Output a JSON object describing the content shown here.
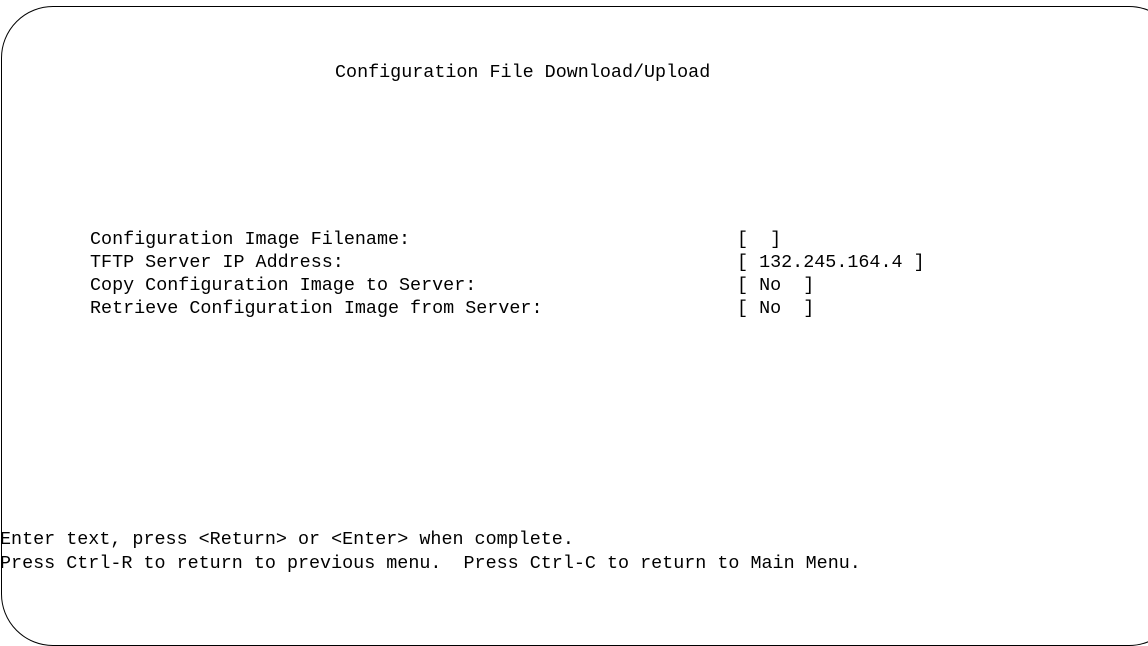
{
  "screen": {
    "title": "Configuration File Download/Upload"
  },
  "fields": [
    {
      "label": "Configuration Image Filename:",
      "value": "[  ]"
    },
    {
      "label": "TFTP Server IP Address:",
      "value": "[ 132.245.164.4 ]"
    },
    {
      "label": "Copy Configuration Image to Server:",
      "value": "[ No  ]"
    },
    {
      "label": "Retrieve Configuration Image from Server:",
      "value": "[ No  ]"
    }
  ],
  "help": {
    "line1": "Enter text, press <Return> or <Enter> when complete.",
    "line2": "Press Ctrl-R to return to previous menu.  Press Ctrl-C to return to Main Menu."
  }
}
